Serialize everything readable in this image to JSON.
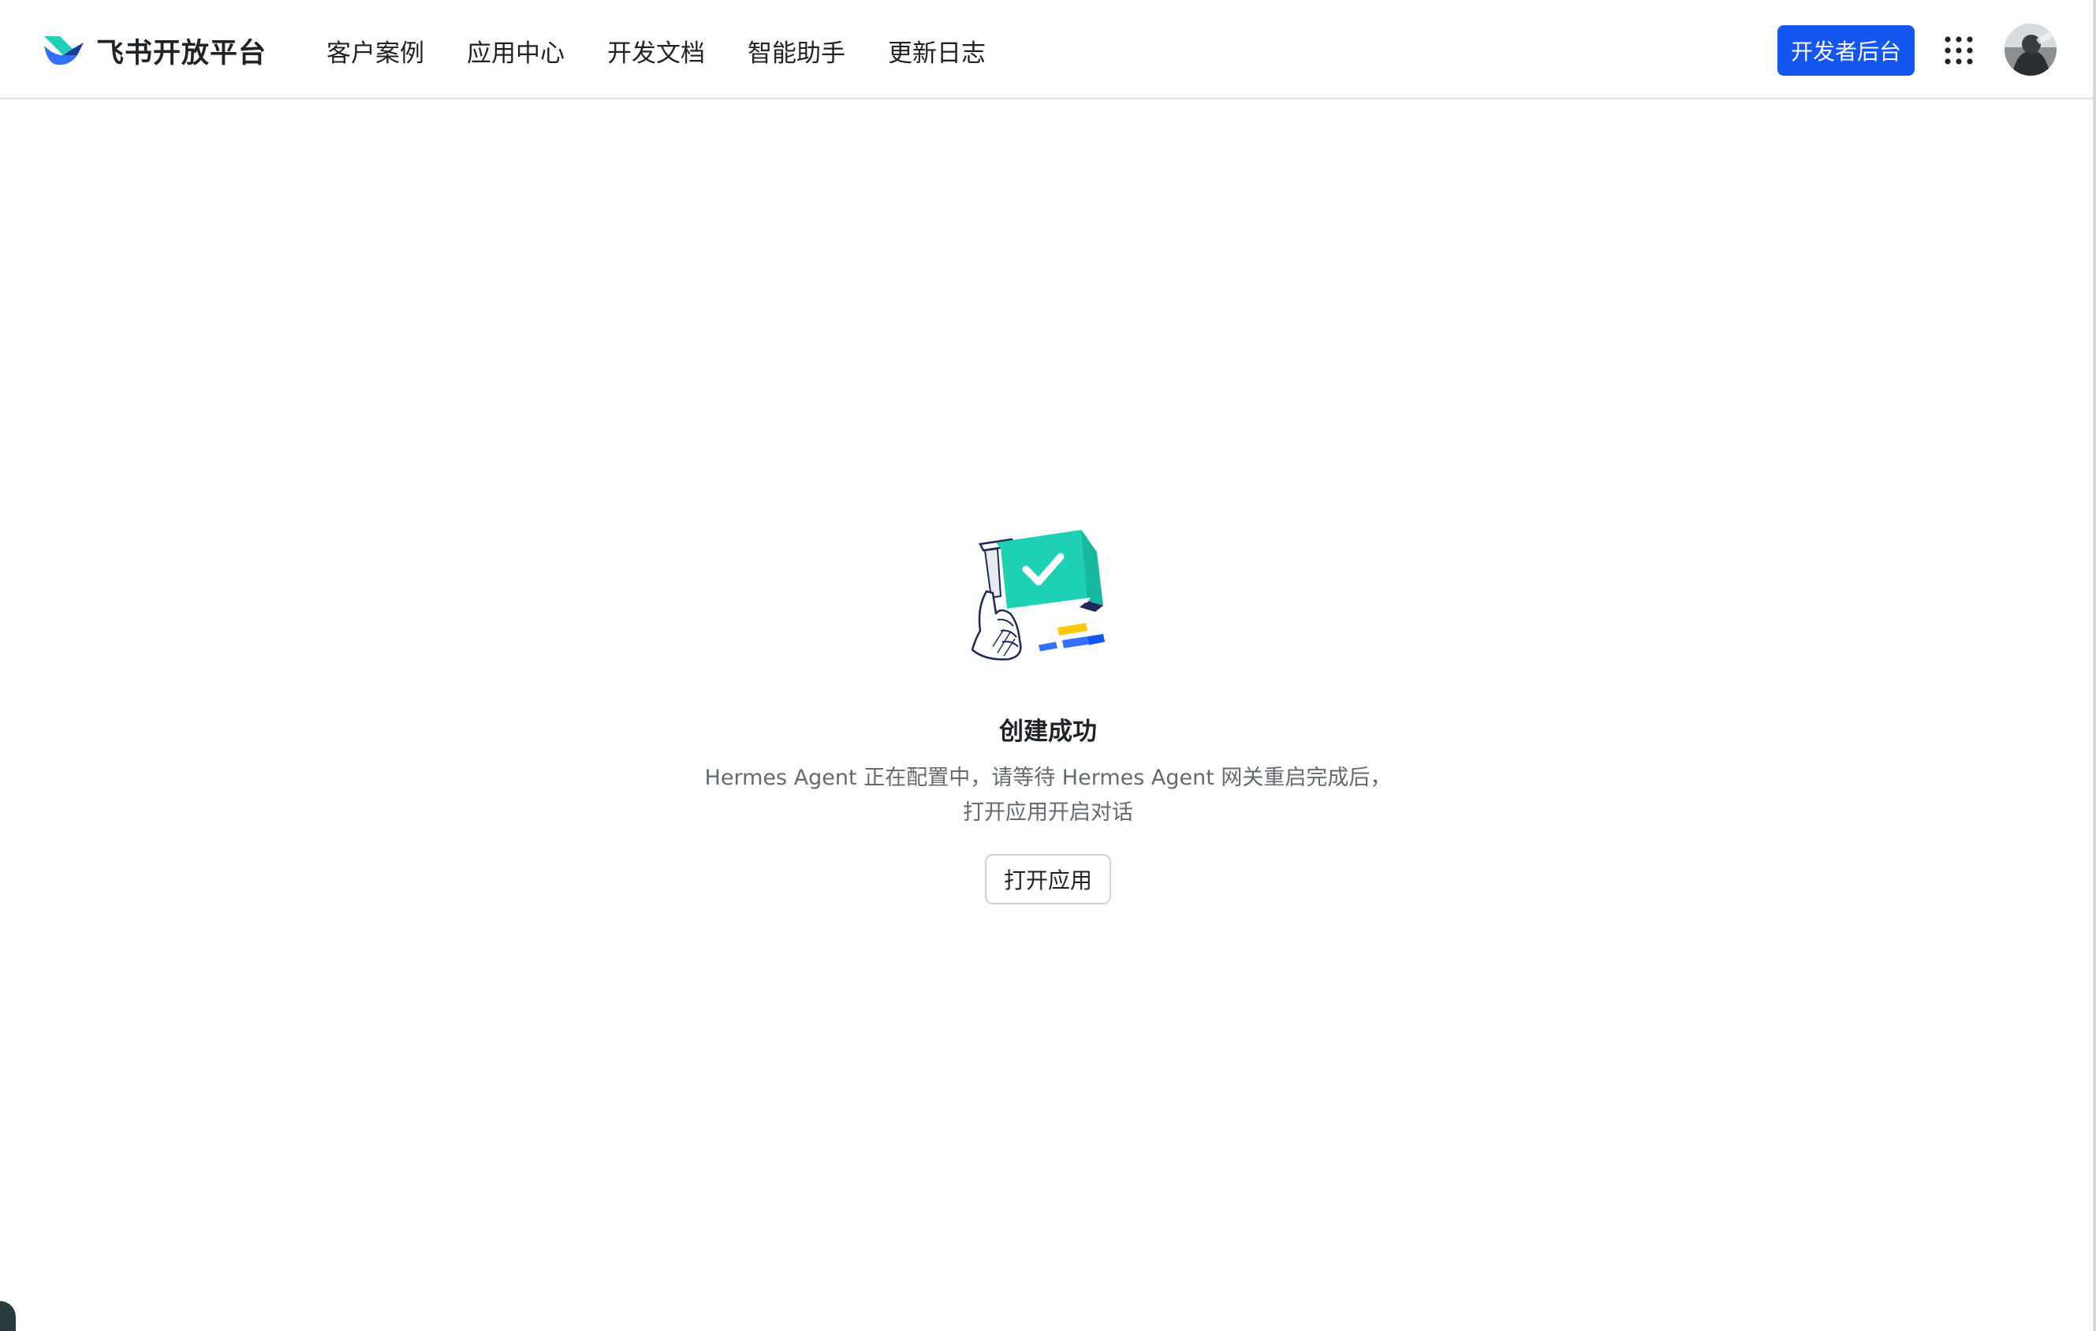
{
  "header": {
    "brand_name": "飞书开放平台",
    "nav": [
      {
        "label": "客户案例"
      },
      {
        "label": "应用中心"
      },
      {
        "label": "开发文档"
      },
      {
        "label": "智能助手"
      },
      {
        "label": "更新日志"
      }
    ],
    "console_button": "开发者后台",
    "apps_icon": "grid-dots-icon",
    "avatar_icon": "user-avatar"
  },
  "result": {
    "illustration_icon": "success-flag-illustration",
    "title": "创建成功",
    "desc_line1": "Hermes Agent 正在配置中，请等待 Hermes Agent 网关重启完成后，",
    "desc_line2": "打开应用开启对话",
    "open_button": "打开应用"
  },
  "colors": {
    "primary": "#1456f0",
    "accent_teal": "#1fd1b4",
    "text_primary": "#1f2329",
    "text_secondary": "#646a73"
  }
}
